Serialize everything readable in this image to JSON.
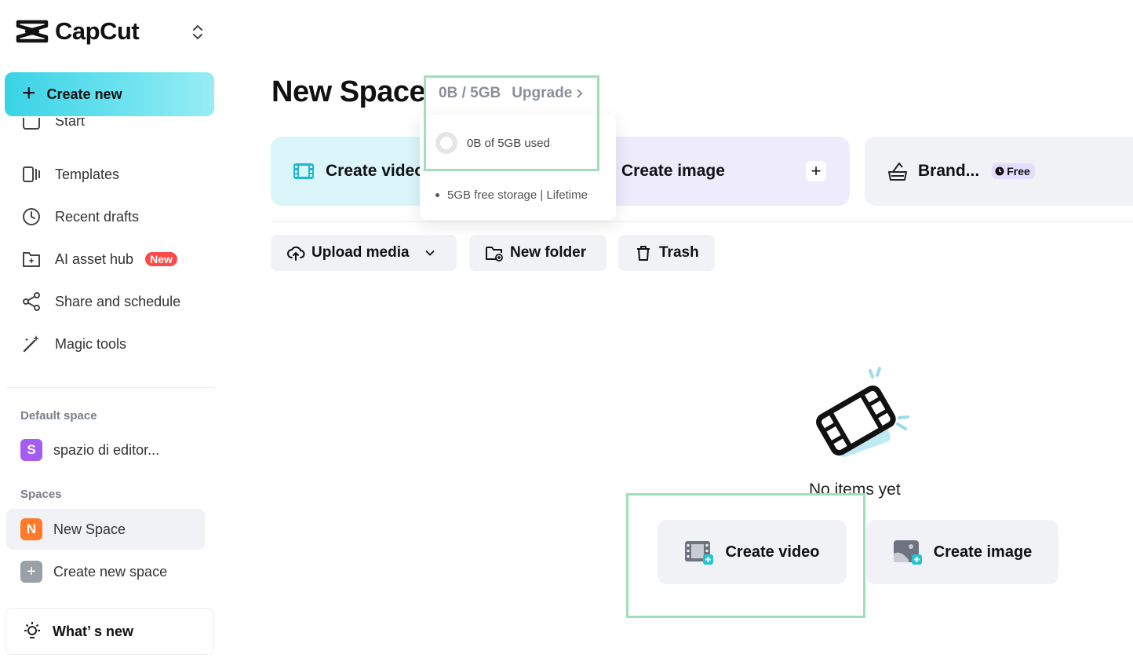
{
  "app": {
    "name": "CapCut"
  },
  "sidebar": {
    "create_new": "Create new",
    "partial_item": "Start",
    "items": [
      {
        "label": "Templates"
      },
      {
        "label": "Recent drafts"
      },
      {
        "label": "AI asset hub",
        "badge": "New"
      },
      {
        "label": "Share and schedule"
      },
      {
        "label": "Magic tools"
      }
    ],
    "default_space_label": "Default space",
    "default_space": {
      "avatar": "S",
      "name": "spazio di editor...",
      "color": "#a55cf0"
    },
    "spaces_label": "Spaces",
    "spaces": [
      {
        "avatar": "N",
        "name": "New Space",
        "color": "#ff7a29"
      }
    ],
    "create_space": {
      "avatar": "+",
      "label": "Create new space"
    },
    "whats_new": "What’ s new"
  },
  "main": {
    "title": "New Space",
    "storage": {
      "usage": "0B / 5GB",
      "upgrade": "Upgrade"
    },
    "popover": {
      "used": "0B of 5GB used",
      "bullet": "5GB free storage | Lifetime"
    },
    "cards": {
      "video": "Create video",
      "image": "Create image",
      "brand": "Brand...",
      "brand_badge": "Free"
    },
    "toolbar": {
      "upload": "Upload media",
      "new_folder": "New folder",
      "trash": "Trash"
    },
    "empty": {
      "title": "No items yet",
      "create_video": "Create video",
      "create_image": "Create image"
    }
  },
  "colors": {
    "accent": "#39d3e6",
    "highlight": "#9ee0b9",
    "badge_red": "#fe4a4a",
    "video_card": "#daf6fb",
    "image_card": "#eeebfd"
  }
}
